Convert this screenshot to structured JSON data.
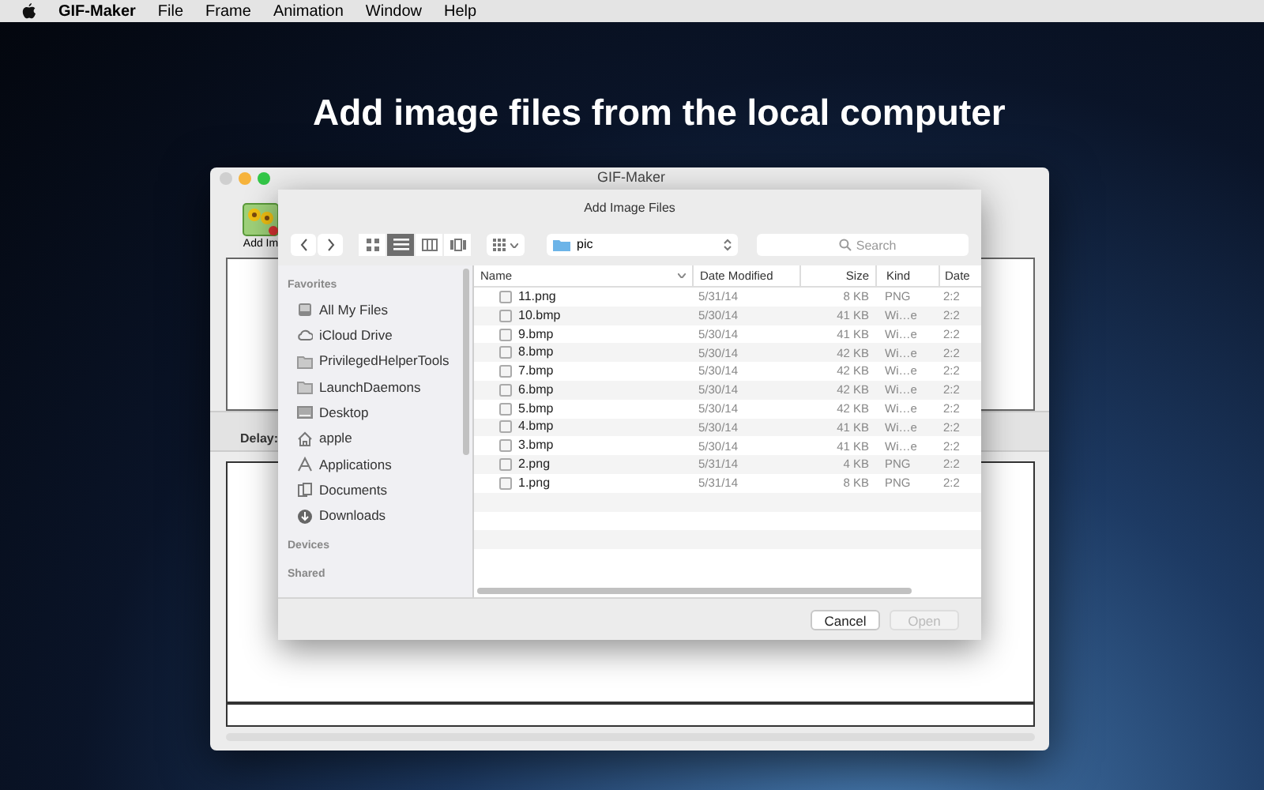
{
  "menu_bar": {
    "app_name": "GIF-Maker",
    "items": [
      "File",
      "Frame",
      "Animation",
      "Window",
      "Help"
    ]
  },
  "headline": "Add image files from the local computer",
  "window": {
    "title": "GIF-Maker",
    "toolbar_button": "Add Im",
    "delay_label": "Delay:"
  },
  "dialog": {
    "title": "Add Image Files",
    "view_modes": [
      {
        "kind": "icons",
        "selected": false
      },
      {
        "kind": "list",
        "selected": true
      },
      {
        "kind": "columns",
        "selected": false
      },
      {
        "kind": "coverflow",
        "selected": false
      }
    ],
    "location": "pic",
    "search": {
      "placeholder": "Search"
    },
    "sidebar": [
      {
        "heading": "Favorites",
        "items": [
          {
            "label": "All My Files",
            "kind": "allfiles"
          },
          {
            "label": "iCloud Drive",
            "kind": "cloud"
          },
          {
            "label": "PrivilegedHelperTools",
            "kind": "folder"
          },
          {
            "label": "LaunchDaemons",
            "kind": "folder"
          },
          {
            "label": "Desktop",
            "kind": "desktop"
          },
          {
            "label": "apple",
            "kind": "home"
          },
          {
            "label": "Applications",
            "kind": "apps"
          },
          {
            "label": "Documents",
            "kind": "docs"
          },
          {
            "label": "Downloads",
            "kind": "downloads"
          }
        ]
      },
      {
        "heading": "Devices"
      },
      {
        "heading": "Shared"
      }
    ],
    "columns": [
      "Name",
      "Date Modified",
      "Size",
      "Kind",
      "Date"
    ],
    "files": [
      [
        "11.png",
        "5/31/14",
        "8 KB",
        "PNG",
        "2:2"
      ],
      [
        "10.bmp",
        "5/30/14",
        "41 KB",
        "Wi…e",
        "2:2"
      ],
      [
        "9.bmp",
        "5/30/14",
        "41 KB",
        "Wi…e",
        "2:2"
      ],
      [
        "8.bmp",
        "5/30/14",
        "42 KB",
        "Wi…e",
        "2:2"
      ],
      [
        "7.bmp",
        "5/30/14",
        "42 KB",
        "Wi…e",
        "2:2"
      ],
      [
        "6.bmp",
        "5/30/14",
        "42 KB",
        "Wi…e",
        "2:2"
      ],
      [
        "5.bmp",
        "5/30/14",
        "42 KB",
        "Wi…e",
        "2:2"
      ],
      [
        "4.bmp",
        "5/30/14",
        "41 KB",
        "Wi…e",
        "2:2"
      ],
      [
        "3.bmp",
        "5/30/14",
        "41 KB",
        "Wi…e",
        "2:2"
      ],
      [
        "2.png",
        "5/31/14",
        "4 KB",
        "PNG",
        "2:2"
      ],
      [
        "1.png",
        "5/31/14",
        "8 KB",
        "PNG",
        "2:2"
      ]
    ],
    "buttons": [
      {
        "label": "Cancel",
        "disabled": false
      },
      {
        "label": "Open",
        "disabled": true
      }
    ]
  }
}
